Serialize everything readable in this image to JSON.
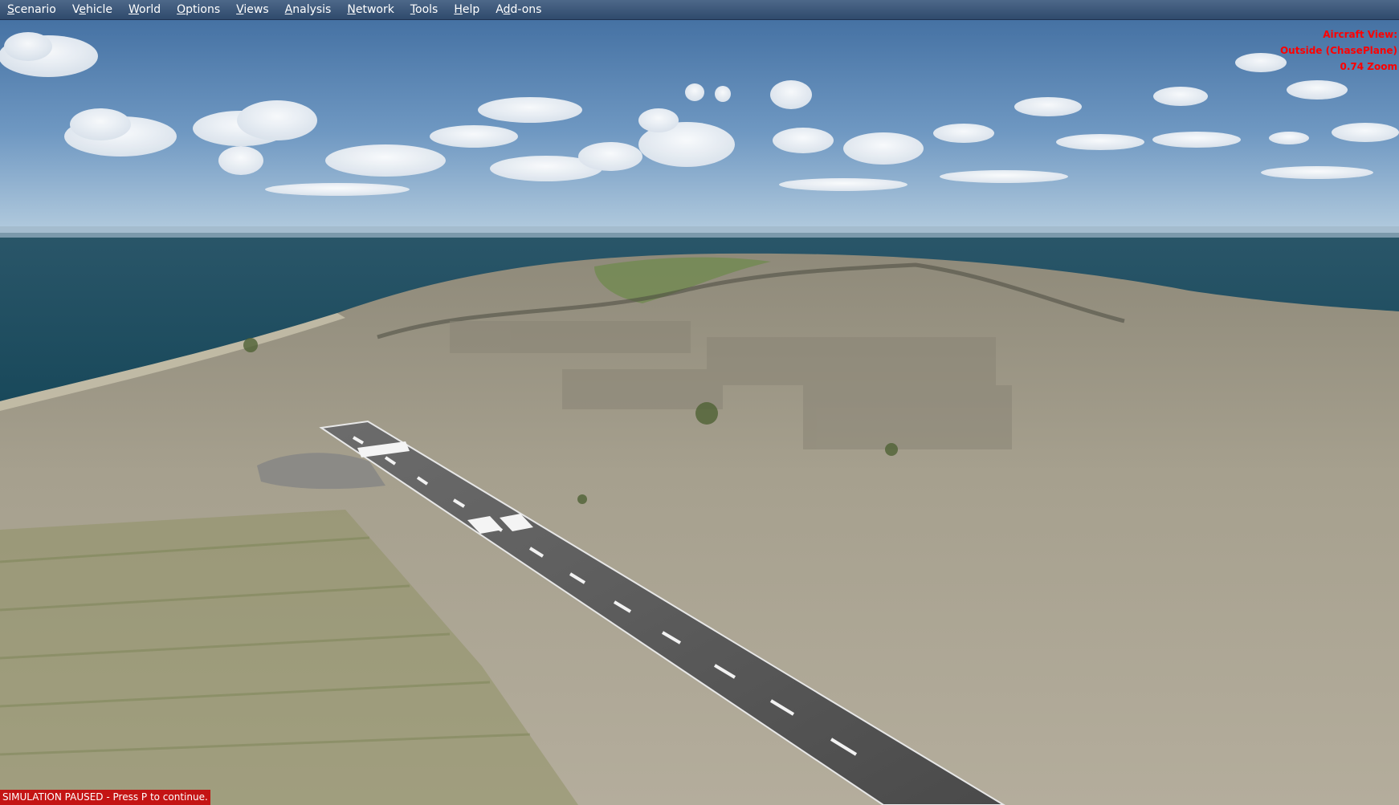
{
  "menu": {
    "items": [
      {
        "id": "scenario",
        "mnemonic": "S",
        "rest": "cenario"
      },
      {
        "id": "vehicle",
        "pre": "V",
        "mnemonic": "e",
        "rest": "hicle"
      },
      {
        "id": "world",
        "mnemonic": "W",
        "rest": "orld"
      },
      {
        "id": "options",
        "mnemonic": "O",
        "rest": "ptions"
      },
      {
        "id": "views",
        "mnemonic": "V",
        "rest": "iews"
      },
      {
        "id": "analysis",
        "mnemonic": "A",
        "rest": "nalysis"
      },
      {
        "id": "network",
        "mnemonic": "N",
        "rest": "etwork"
      },
      {
        "id": "tools",
        "mnemonic": "T",
        "rest": "ools"
      },
      {
        "id": "help",
        "mnemonic": "H",
        "rest": "elp"
      },
      {
        "id": "addons",
        "pre": "A",
        "mnemonic": "d",
        "rest": "d-ons"
      }
    ]
  },
  "overlay": {
    "aircraft_view_title": "Aircraft View:",
    "aircraft_view_mode": "Outside (ChasePlane)",
    "zoom": "0.74 Zoom"
  },
  "status": {
    "paused_message": "SIMULATION PAUSED - Press P to continue."
  },
  "colors": {
    "menu_bar": "#3c577a",
    "overlay_text": "#ff0000",
    "pause_banner": "#c41414",
    "sky_top": "#3f6fa3",
    "sea": "#1f4f63",
    "ground": "#a49d8b"
  }
}
